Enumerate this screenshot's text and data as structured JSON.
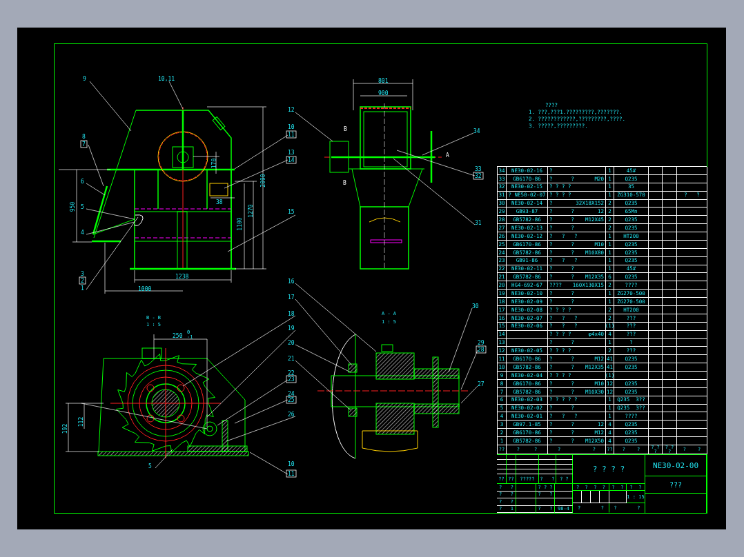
{
  "drawing": {
    "labels": [
      {
        "kind": "balloon",
        "text": "9"
      },
      {
        "kind": "balloon",
        "text": "10,11"
      },
      {
        "kind": "balloon",
        "text": "8"
      },
      {
        "kind": "boxed",
        "text": "7"
      },
      {
        "kind": "balloon",
        "text": "6"
      },
      {
        "kind": "balloon",
        "text": "5"
      },
      {
        "kind": "balloon",
        "text": "4"
      },
      {
        "kind": "balloon",
        "text": "3"
      },
      {
        "kind": "boxed",
        "text": "2"
      },
      {
        "kind": "balloon",
        "text": "1"
      },
      {
        "kind": "balloon",
        "text": "12"
      },
      {
        "kind": "balloon",
        "text": "10"
      },
      {
        "kind": "boxed",
        "text": "11"
      },
      {
        "kind": "balloon",
        "text": "13"
      },
      {
        "kind": "boxed",
        "text": "14"
      },
      {
        "kind": "balloon",
        "text": "15"
      },
      {
        "kind": "dim",
        "text": "1238"
      },
      {
        "kind": "dim",
        "text": "1000"
      },
      {
        "kind": "vdim",
        "text": "950"
      },
      {
        "kind": "vdim",
        "text": "2090"
      },
      {
        "kind": "vdim",
        "text": "170"
      },
      {
        "kind": "dim",
        "text": "38"
      },
      {
        "kind": "vdim",
        "text": "1100"
      },
      {
        "kind": "vdim",
        "text": "1270"
      },
      {
        "kind": "dim",
        "text": "801"
      },
      {
        "kind": "dim",
        "text": "900"
      },
      {
        "kind": "letter",
        "text": "B"
      },
      {
        "kind": "letter",
        "text": "B"
      },
      {
        "kind": "letter",
        "text": "A"
      },
      {
        "kind": "balloon",
        "text": "34"
      },
      {
        "kind": "balloon",
        "text": "33"
      },
      {
        "kind": "boxed",
        "text": "32"
      },
      {
        "kind": "balloon",
        "text": "31"
      },
      {
        "kind": "balloon",
        "text": "16"
      },
      {
        "kind": "balloon",
        "text": "17"
      },
      {
        "kind": "title",
        "text": "B - B"
      },
      {
        "kind": "title",
        "text": "1 : 5"
      },
      {
        "kind": "dim",
        "text": "250"
      },
      {
        "kind": "tol",
        "text": "0"
      },
      {
        "kind": "tol",
        "text": "-1"
      },
      {
        "kind": "vdim",
        "text": "192"
      },
      {
        "kind": "vdim",
        "text": "112"
      },
      {
        "kind": "balloon",
        "text": "5"
      },
      {
        "kind": "balloon",
        "text": "18"
      },
      {
        "kind": "balloon",
        "text": "19"
      },
      {
        "kind": "balloon",
        "text": "20"
      },
      {
        "kind": "balloon",
        "text": "21"
      },
      {
        "kind": "balloon",
        "text": "22"
      },
      {
        "kind": "boxed",
        "text": "23"
      },
      {
        "kind": "balloon",
        "text": "24"
      },
      {
        "kind": "boxed",
        "text": "25"
      },
      {
        "kind": "balloon",
        "text": "26"
      },
      {
        "kind": "balloon",
        "text": "10"
      },
      {
        "kind": "boxed",
        "text": "11"
      },
      {
        "kind": "title",
        "text": "A - A"
      },
      {
        "kind": "title",
        "text": "1 : 5"
      },
      {
        "kind": "balloon",
        "text": "30"
      },
      {
        "kind": "balloon",
        "text": "29"
      },
      {
        "kind": "boxed",
        "text": "28"
      },
      {
        "kind": "balloon",
        "text": "27"
      }
    ]
  },
  "notes": {
    "title": "????",
    "lines": [
      "1. ???,???1.?????????,???????.",
      "2. ????????????,?????????,????.",
      "3. ?????,?????????."
    ]
  },
  "parts_table": {
    "rows": [
      {
        "no": "34",
        "code": "NE30-02-16",
        "name": "?",
        "qty": "1",
        "material": "45#"
      },
      {
        "no": "33",
        "code": "GB6170-86",
        "name": "?      ?",
        "spec": "M20",
        "qty": "1",
        "material": "Q235"
      },
      {
        "no": "32",
        "code": "NE30-02-15",
        "name": "? ? ? ?",
        "qty": "1",
        "material": "35"
      },
      {
        "no": "31",
        "code": "? NE50-02-07",
        "name": "? ? ? ?",
        "qty": "1",
        "material": "ZG310-570",
        "remark": "?   ?"
      },
      {
        "no": "30",
        "code": "NE30-02-14",
        "name": "?",
        "spec": "32X18X152",
        "qty": "2",
        "material": "Q235"
      },
      {
        "no": "29",
        "code": "GB93-87",
        "name": "?      ?",
        "spec": "12",
        "qty": "2",
        "material": "65Mn"
      },
      {
        "no": "28",
        "code": "GB5782-86",
        "name": "?      ?",
        "spec": "M12X45",
        "qty": "2",
        "material": "Q235"
      },
      {
        "no": "27",
        "code": "NE30-02-13",
        "name": "?      ?",
        "qty": "2",
        "material": "Q235"
      },
      {
        "no": "26",
        "code": "NE30-02-12",
        "name": "?   ?   ?",
        "qty": "1",
        "material": "HT200"
      },
      {
        "no": "25",
        "code": "GB6170-86",
        "name": "?      ?",
        "spec": "M10",
        "qty": "1",
        "material": "Q235"
      },
      {
        "no": "24",
        "code": "GB5782-86",
        "name": "?      ?",
        "spec": "M10X80",
        "qty": "1",
        "material": "Q235"
      },
      {
        "no": "23",
        "code": "GB91-86",
        "name": "?   ?   ?",
        "qty": "1",
        "material": "Q235"
      },
      {
        "no": "22",
        "code": "NE30-02-11",
        "name": "?      ?",
        "qty": "1",
        "material": "45#"
      },
      {
        "no": "21",
        "code": "GB5782-86",
        "name": "?      ?",
        "spec": "M12X35",
        "qty": "6",
        "material": "Q235"
      },
      {
        "no": "20",
        "code": "HG4-692-67",
        "name": "????",
        "spec": "160X130X15",
        "qty": "2",
        "material": "????"
      },
      {
        "no": "19",
        "code": "NE30-02-10",
        "name": "?      ?",
        "qty": "1",
        "material": "ZG270-500"
      },
      {
        "no": "18",
        "code": "NE30-02-09",
        "name": "?      ?",
        "qty": "1",
        "material": "ZG270-500"
      },
      {
        "no": "17",
        "code": "NE30-02-08",
        "name": "? ? ? ?",
        "qty": "2",
        "material": "HT200"
      },
      {
        "no": "16",
        "code": "NE30-02-07",
        "name": "?   ?   ?",
        "qty": "2",
        "material": "???"
      },
      {
        "no": "15",
        "code": "NE30-02-06",
        "name": "?   ?   ?",
        "qty": "(1)",
        "material": "???"
      },
      {
        "no": "14",
        "name": "? ? ? ?",
        "spec": "φ4x40",
        "qty": "4",
        "material": "???"
      },
      {
        "no": "13",
        "name": "?      ?",
        "qty": "1",
        "material": "?"
      },
      {
        "no": "12",
        "code": "NE30-02-05",
        "name": "? ? ? ?",
        "qty": "2",
        "material": "???"
      },
      {
        "no": "11",
        "code": "GB6170-86",
        "name": "?      ?",
        "spec": "M12",
        "qty": "41",
        "material": "Q235"
      },
      {
        "no": "10",
        "code": "GB5782-86",
        "name": "?      ?",
        "spec": "M12X35",
        "qty": "41",
        "material": "Q235"
      },
      {
        "no": "9",
        "code": "NE30-02-04",
        "name": "? ? ? ?",
        "qty": "(1)"
      },
      {
        "no": "8",
        "code": "GB6170-86",
        "name": "?      ?",
        "spec": "M10",
        "qty": "12",
        "material": "Q235"
      },
      {
        "no": "7",
        "code": "GB5782-86",
        "name": "?      ?",
        "spec": "M10X30",
        "qty": "12",
        "material": "Q235"
      },
      {
        "no": "6",
        "code": "NE30-02-03",
        "name": "? ? ? ? ?",
        "qty": "1",
        "material": "Q235  3??"
      },
      {
        "no": "5",
        "code": "NE30-02-02",
        "name": "?      ?",
        "qty": "1",
        "material": "Q235  3??"
      },
      {
        "no": "4",
        "code": "NE30-02-01",
        "name": "?   ?   ?",
        "qty": "1",
        "material": "????"
      },
      {
        "no": "3",
        "code": "GB97.1-85",
        "name": "?      ?",
        "spec": "12",
        "qty": "4",
        "material": "Q235"
      },
      {
        "no": "2",
        "code": "GB6170-86",
        "name": "?      ?",
        "spec": "M12",
        "qty": "4",
        "material": "Q235"
      },
      {
        "no": "1",
        "code": "GB5782-86",
        "name": "?      ?",
        "spec": "M12X50",
        "qty": "4",
        "material": "Q235"
      }
    ],
    "header": [
      {
        "lines": [
          "??"
        ]
      },
      {
        "lines": [
          "?     ?"
        ]
      },
      {
        "lines": [
          "?           ?"
        ]
      },
      {
        "lines": [
          "??"
        ]
      },
      {
        "lines": [
          "?    ?"
        ]
      },
      {
        "lines": [
          "? ?",
          "?"
        ]
      },
      {
        "lines": [
          "? ?",
          "?"
        ]
      },
      {
        "lines": [
          "?    ?"
        ]
      }
    ]
  },
  "title_block": {
    "left_labels": [
      "??",
      "??",
      "?????",
      "?   ?",
      "? ?"
    ],
    "left_rows": [
      {
        "c1": "?   ?",
        "c3": "? ? ?"
      },
      {
        "c1": "?   ?",
        "c3": "?   ?"
      },
      {
        "c1": "?   ?"
      },
      {
        "c1": "?   1",
        "c3": "?   ?",
        "c4": "98-4"
      }
    ],
    "title": "? ? ? ?",
    "marks": [
      "?  ?  ?  ?",
      "?  ?",
      "?  ?"
    ],
    "scale": "1 : 15",
    "footer": [
      "?       ?",
      "?       ?"
    ],
    "drawing_no": "NE30-02-00",
    "unit": "???"
  }
}
